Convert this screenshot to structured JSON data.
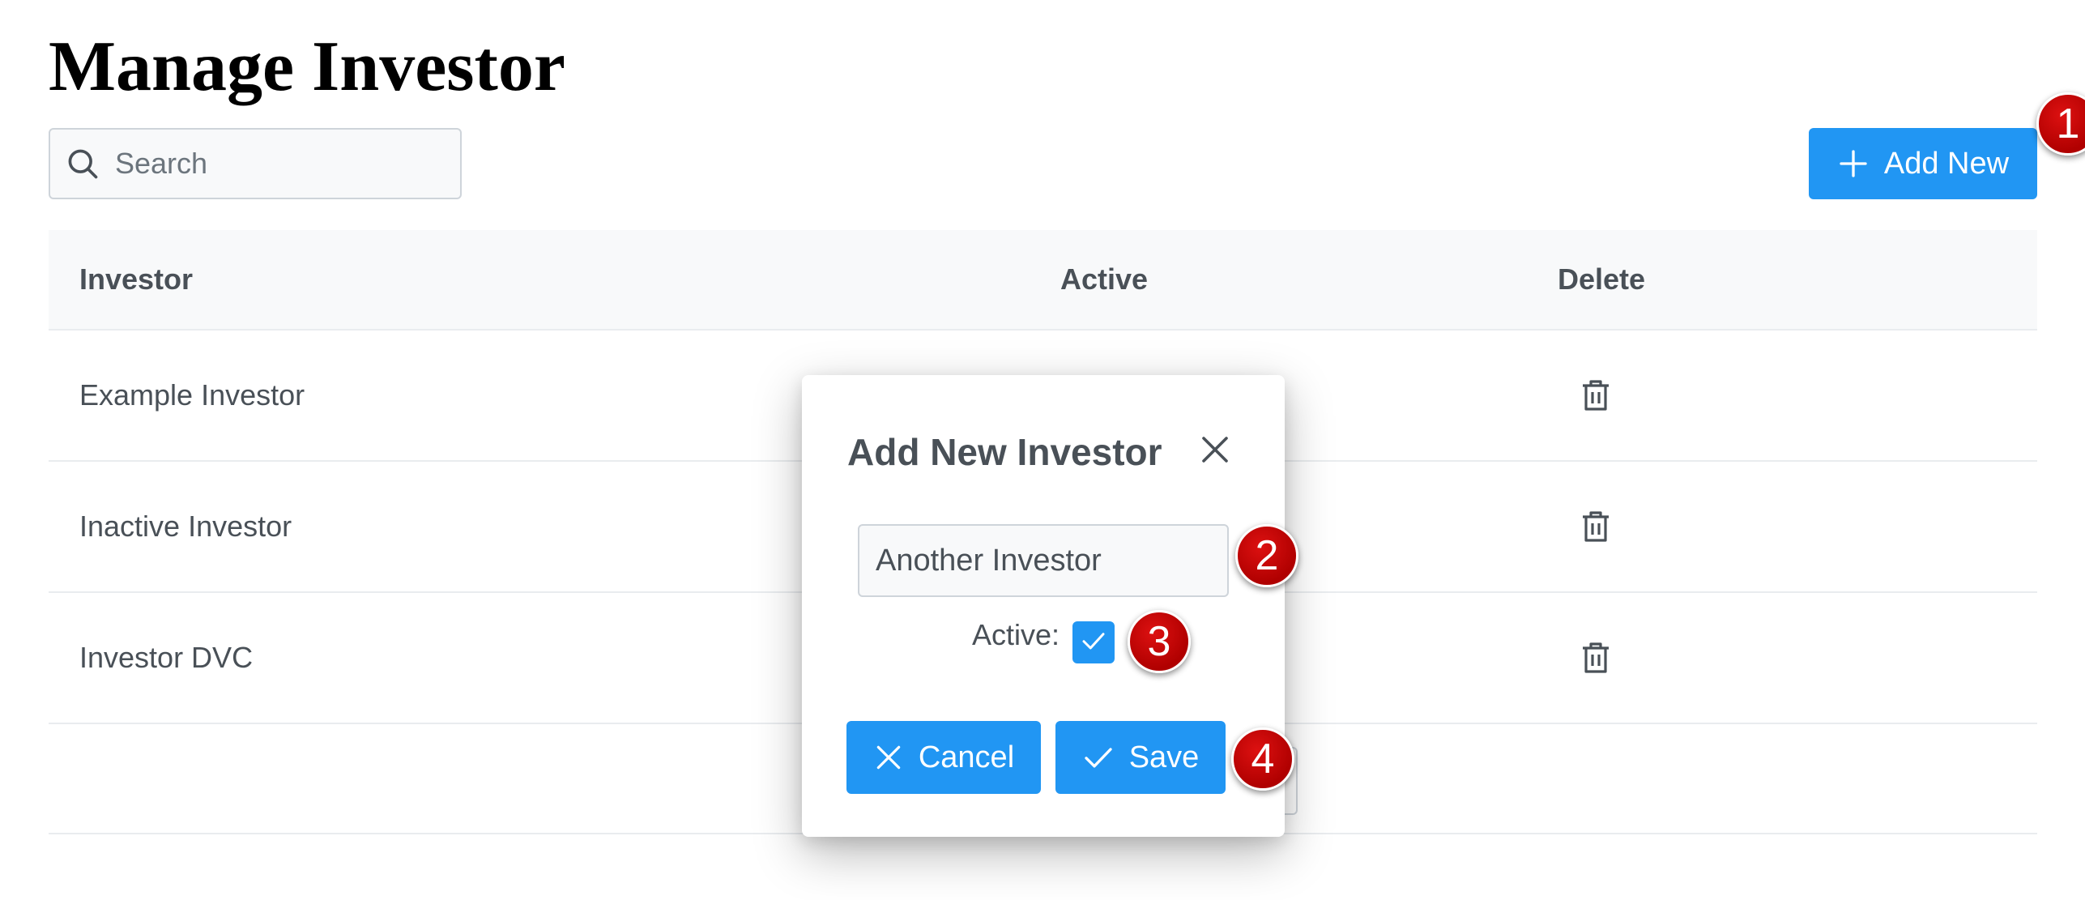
{
  "page": {
    "title": "Manage Investor"
  },
  "search": {
    "placeholder": "Search",
    "icon": "search-icon"
  },
  "toolbar": {
    "add_new_label": "Add New",
    "add_icon": "plus-icon"
  },
  "table": {
    "columns": [
      "Investor",
      "Active",
      "Delete"
    ],
    "rows": [
      {
        "investor": "Example Investor"
      },
      {
        "investor": "Inactive Investor"
      },
      {
        "investor": "Investor DVC"
      }
    ],
    "delete_icon": "trash-icon"
  },
  "dialog": {
    "title": "Add New Investor",
    "close_icon": "close-icon",
    "name_value": "Another Investor",
    "active_label": "Active:",
    "active_checked": true,
    "cancel_label": "Cancel",
    "save_label": "Save"
  },
  "annotations": [
    "1",
    "2",
    "3",
    "4"
  ],
  "colors": {
    "primary": "#2196f3",
    "badge": "#c00000"
  }
}
